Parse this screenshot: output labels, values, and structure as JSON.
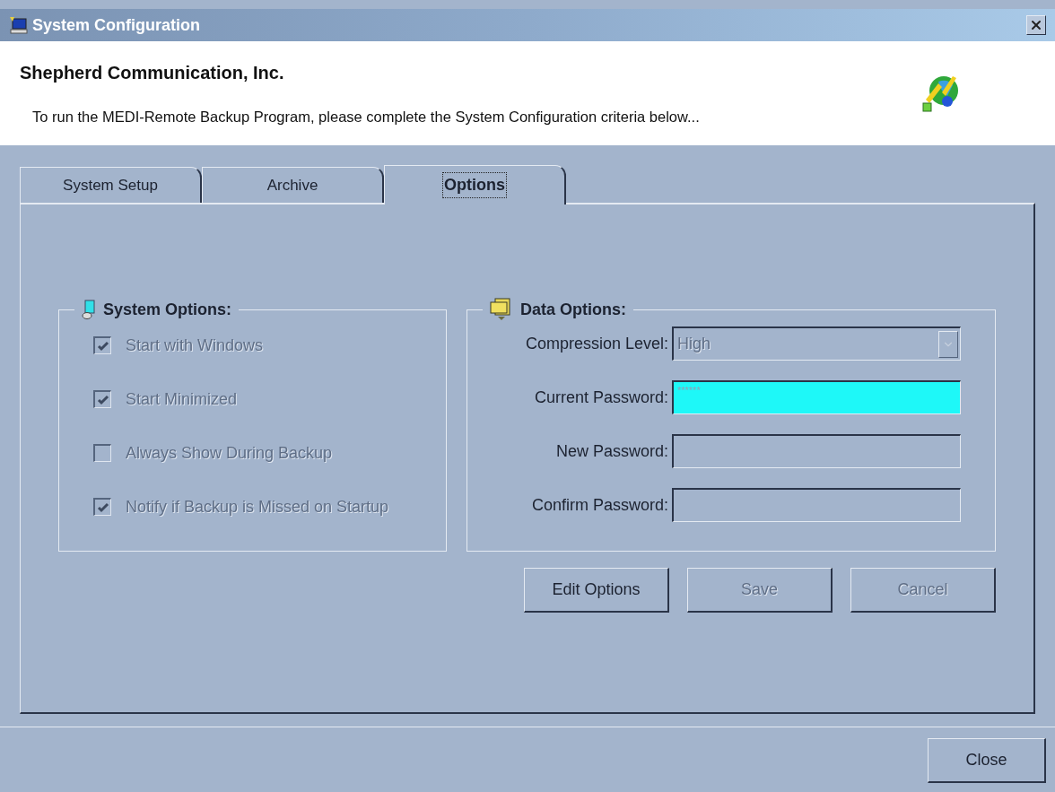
{
  "window": {
    "title": "System Configuration"
  },
  "header": {
    "company": "Shepherd Communication, Inc.",
    "instructions": "To run the MEDI-Remote Backup Program, please complete the System Configuration criteria below..."
  },
  "tabs": [
    {
      "label": "System Setup",
      "selected": false
    },
    {
      "label": "Archive",
      "selected": false
    },
    {
      "label": "Options",
      "selected": true
    }
  ],
  "system_options": {
    "title": "System Options:",
    "items": [
      {
        "label": "Start with Windows",
        "checked": true,
        "disabled": true
      },
      {
        "label": "Start Minimized",
        "checked": true,
        "disabled": true
      },
      {
        "label": "Always Show During Backup",
        "checked": false,
        "disabled": true
      },
      {
        "label": "Notify if Backup is Missed on Startup",
        "checked": true,
        "disabled": true
      }
    ]
  },
  "data_options": {
    "title": "Data Options:",
    "fields": [
      {
        "kind": "select",
        "label": "Compression Level:",
        "value": "High",
        "focused": false
      },
      {
        "kind": "password",
        "label": "Current Password:",
        "value": "******",
        "focused": true
      },
      {
        "kind": "password",
        "label": "New Password:",
        "focused": false
      },
      {
        "kind": "password",
        "label": "Confirm Password:",
        "focused": false
      }
    ]
  },
  "actions": [
    {
      "label": "Edit Options",
      "disabled": false
    },
    {
      "label": "Save",
      "disabled": true
    },
    {
      "label": "Cancel",
      "disabled": true
    }
  ],
  "footer": {
    "close_button": "Close"
  }
}
